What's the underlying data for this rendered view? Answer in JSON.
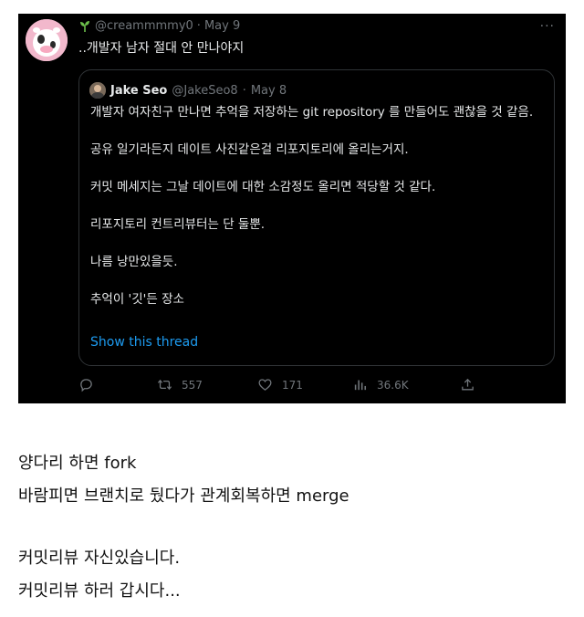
{
  "tweet": {
    "handle": "@creammmmy0",
    "sep1": "·",
    "date": "May 9",
    "text": "..개발자 남자 절대 안 만나야지",
    "more": "···"
  },
  "quote": {
    "name": "Jake Seo",
    "handle": "@JakeSeo8",
    "sep": "·",
    "date": "May 8",
    "paragraphs": [
      "개발자 여자친구 만나면 추억을 저장하는 git repository 를 만들어도 괜찮을 것 같음.",
      "공유 일기라든지 데이트 사진같은걸 리포지토리에 올리는거지.",
      "커밋 메세지는 그날 데이트에 대한 소감정도 올리면 적당할 것 같다.",
      "리포지토리 컨트리뷰터는 단 둘뿐.",
      "나름 낭만있을듯.",
      "추억이 '깃'든 장소"
    ],
    "show_thread": "Show this thread"
  },
  "actions": {
    "reply_count": "",
    "retweets": "557",
    "likes": "171",
    "views": "36.6K",
    "icons": [
      "reply-icon",
      "retweet-icon",
      "like-icon",
      "views-icon",
      "share-icon"
    ]
  },
  "caption": {
    "line1": "양다리 하면 fork",
    "line2": "바람피면 브랜치로 뒀다가 관계회복하면 merge",
    "line3": "커밋리뷰 자신있습니다.",
    "line4": "커밋리뷰 하러 갑시다..."
  },
  "colors": {
    "background": "#000000",
    "text": "#e7e9ea",
    "muted": "#71767b",
    "link": "#1d9bf0",
    "border": "#2f3336"
  }
}
